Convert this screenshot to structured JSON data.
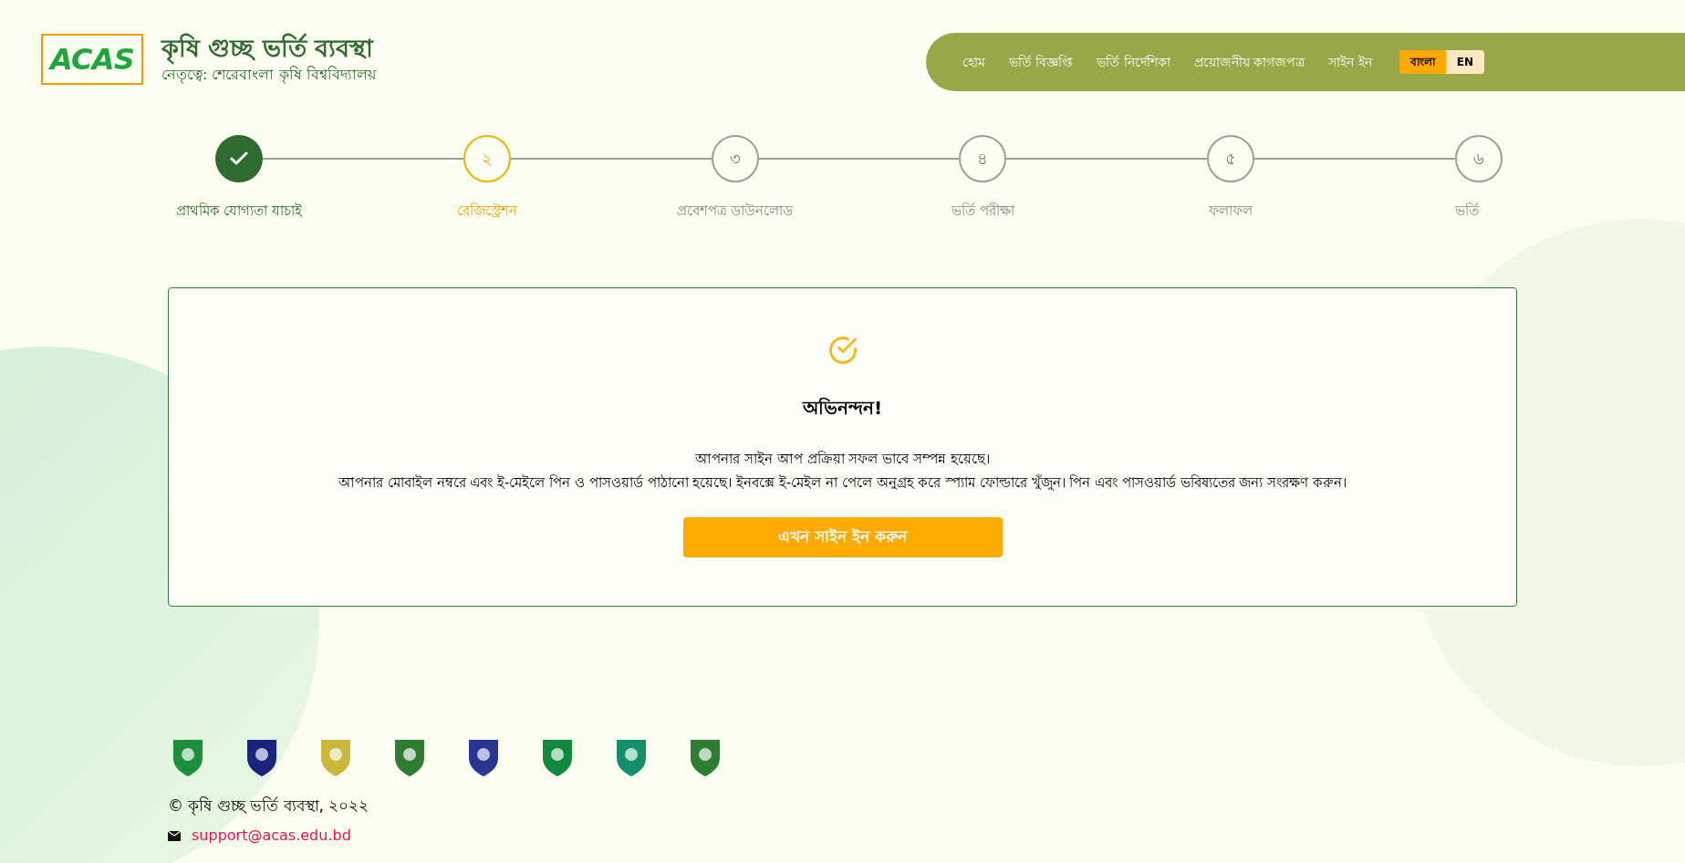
{
  "header": {
    "logo": "ACAS",
    "title": "কৃষি গুচ্ছ ভর্তি ব্যবস্থা",
    "subtitle": "নেতৃত্বে: শেরেবাংলা কৃষি বিশ্ববিদ্যালয়"
  },
  "nav": {
    "links": [
      "হোম",
      "ভর্তি বিজ্ঞপ্তি",
      "ভর্তি নির্দেশিকা",
      "প্রয়োজনীয় কাগজপত্র",
      "সাইন ইন"
    ],
    "languages": [
      {
        "label": "বাংলা",
        "selected": true
      },
      {
        "label": "EN",
        "selected": false
      }
    ]
  },
  "steps": [
    {
      "label": "প্রাথমিক যোগ্যতা যাচাই",
      "kind": "done"
    },
    {
      "number": "২",
      "label": "রেজিস্ট্রেশন",
      "kind": "current"
    },
    {
      "number": "৩",
      "label": "প্রবেশপত্র ডাউনলোড",
      "kind": "pending"
    },
    {
      "number": "৪",
      "label": "ভর্তি পরীক্ষা",
      "kind": "pending"
    },
    {
      "number": "৫",
      "label": "ফলাফল",
      "kind": "pending"
    },
    {
      "number": "৬",
      "label": "ভর্তি",
      "kind": "pending"
    }
  ],
  "card": {
    "heading": "অভিনন্দন!",
    "lines": [
      "আপনার সাইন আপ প্রক্রিয়া সফল ভাবে সম্পন্ন হয়েছে।",
      "আপনার মোবাইল নম্বরে এবং ই-মেইলে পিন ও পাসওয়ার্ড পাঠানো হয়েছে। ইনবক্সে ই-মেইল না পেলে অনুগ্রহ করে স্প্যাম ফোল্ডারে খুঁজুন। পিন এবং পাসওয়ার্ড ভবিষ্যতের জন্য সংরক্ষণ করুন।"
    ],
    "button": "এখন সাইন ইন করুন"
  },
  "footer": {
    "copyright": "© কৃষি গুচ্ছ ভর্তি ব্যবস্থা, ২০২২",
    "email": "support@acas.edu.bd"
  }
}
